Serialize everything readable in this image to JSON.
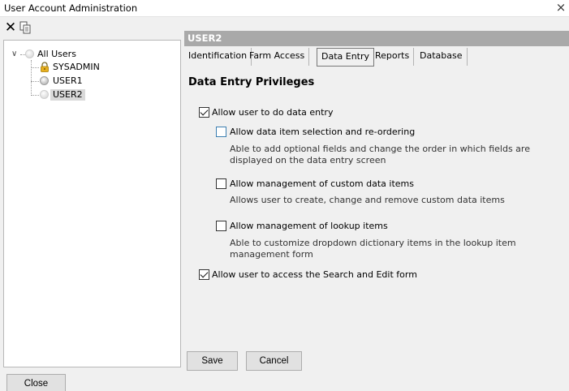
{
  "window": {
    "title": "User Account Administration",
    "close_glyph": "×"
  },
  "toolbar": {
    "delete_glyph": "✕",
    "copy_icon": "copy-icon"
  },
  "tree": {
    "root": {
      "label": "All Users",
      "icon": "circle-icon"
    },
    "users": [
      {
        "label": "SYSADMIN",
        "icon": "lock-icon",
        "selected": false
      },
      {
        "label": "USER1",
        "icon": "circle-icon",
        "selected": false
      },
      {
        "label": "USER2",
        "icon": "circle-icon",
        "selected": true
      }
    ]
  },
  "footer": {
    "close_label": "Close"
  },
  "user_panel": {
    "header": "USER2",
    "tabs": [
      {
        "label": "Identification",
        "active": false
      },
      {
        "label": "Farm Access",
        "active": false
      },
      {
        "label": "Data Entry",
        "active": true
      },
      {
        "label": "Reports",
        "active": false
      },
      {
        "label": "Database",
        "active": false
      }
    ],
    "section_title": "Data Entry Privileges",
    "options": {
      "allow_data_entry": {
        "label": "Allow user to do data entry",
        "checked": true
      },
      "selection_reordering": {
        "label": "Allow data item selection and re-ordering",
        "checked": false,
        "description": "Able to add optional fields and change the order in which fields are displayed on the data entry screen"
      },
      "custom_items": {
        "label": "Allow management of custom data items",
        "checked": false,
        "description": "Allows user to create, change and remove custom data items"
      },
      "lookup_items": {
        "label": "Allow management of lookup items",
        "checked": false,
        "description": "Able to customize dropdown dictionary items in the lookup item management form"
      },
      "search_edit": {
        "label": "Allow user to access the Search and Edit form",
        "checked": true
      }
    },
    "save_label": "Save",
    "cancel_label": "Cancel"
  },
  "colors": {
    "header_bg": "#a9a9a9",
    "focus_blue": "#3c7fb1"
  }
}
